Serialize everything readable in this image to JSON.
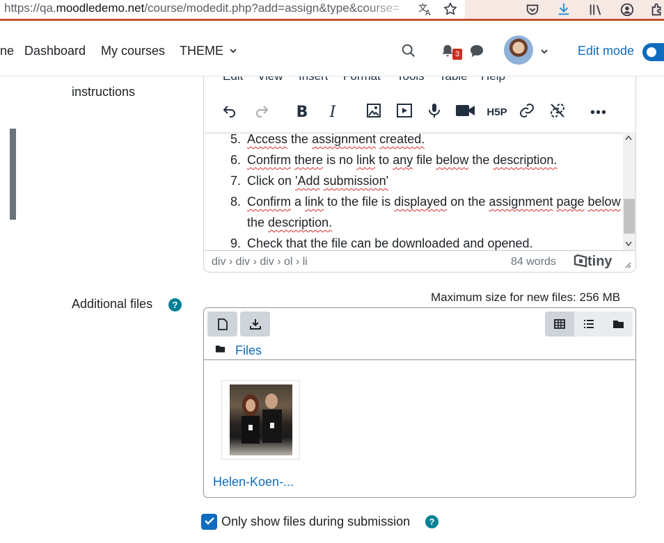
{
  "browser": {
    "url_prefix": "https://qa.",
    "url_domain": "moodledemo.net",
    "url_rest": "/course/modedit.php?add=assign&type&course="
  },
  "nav": {
    "partial_item": "ne",
    "dashboard": "Dashboard",
    "my_courses": "My courses",
    "theme": "THEME",
    "notifications_count": "3",
    "edit_mode": "Edit mode"
  },
  "form": {
    "instructions_label": "instructions",
    "additional_files_label": "Additional files",
    "help_glyph": "?",
    "only_show_label": "Only show files during submission"
  },
  "editor": {
    "menu": [
      "Edit",
      "View",
      "Insert",
      "Format",
      "Tools",
      "Table",
      "Help"
    ],
    "list_items": [
      {
        "num": "5.",
        "text": "Access the assignment created."
      },
      {
        "num": "6.",
        "text": "Confirm there is no link to any file below the description."
      },
      {
        "num": "7.",
        "text": "Click on 'Add submission'"
      },
      {
        "num": "8.",
        "text": "Confirm a link to the file is displayed on the assignment page below the description."
      },
      {
        "num": "9.",
        "text": "Check that the file can be downloaded and opened."
      }
    ],
    "path": "div › div › div › ol › li",
    "word_count": "84 words",
    "brand": "tiny"
  },
  "filemanager": {
    "max_size": "Maximum size for new files: 256 MB",
    "breadcrumb": "Files",
    "file_name": "Helen-Koen-..."
  },
  "colors": {
    "link": "#0f6cbf",
    "help": "#008196",
    "firefox_accent": "#c0532a"
  }
}
